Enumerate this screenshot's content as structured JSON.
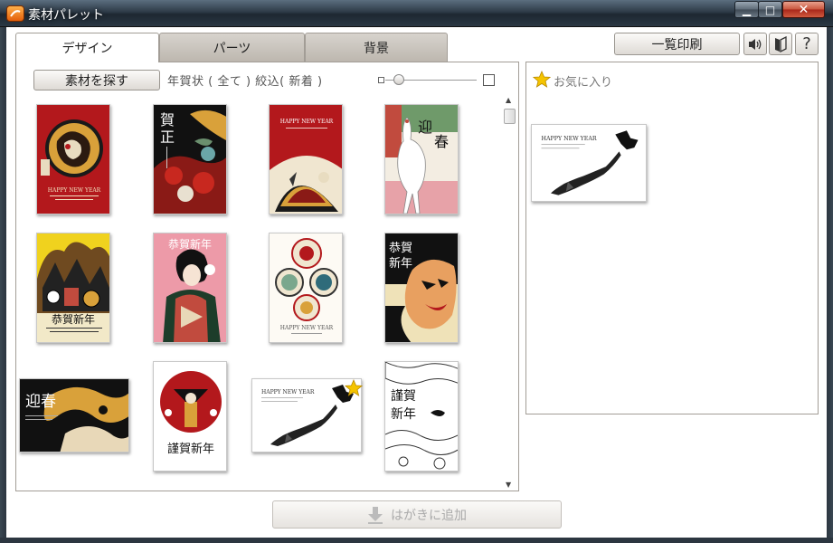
{
  "window": {
    "title": "素材パレット",
    "close_label": "✕"
  },
  "tabs": [
    {
      "label": "デザイン",
      "active": true
    },
    {
      "label": "パーツ",
      "active": false
    },
    {
      "label": "背景",
      "active": false
    }
  ],
  "toolbar": {
    "search_label": "素材を探す",
    "filter_text": "年賀状 ( 全て ) 絞込( 新着 )",
    "zoom_level": 0.15
  },
  "header_buttons": {
    "print_label": "一覧印刷",
    "help_label": "?"
  },
  "favorites": {
    "label": "お気に入り"
  },
  "card_texts": {
    "happy_new_year": "HAPPY NEW YEAR",
    "gashi": "賀正",
    "geishun": "迎春",
    "kyoga_shinnen": "恭賀新年",
    "kinga_shinnen": "謹賀新年"
  },
  "footer": {
    "add_label": "はがきに追加"
  },
  "colors": {
    "accent_orange": "#e35f0b",
    "card_red": "#b3181c",
    "gold": "#d9a13a",
    "star": "#f5c400"
  }
}
